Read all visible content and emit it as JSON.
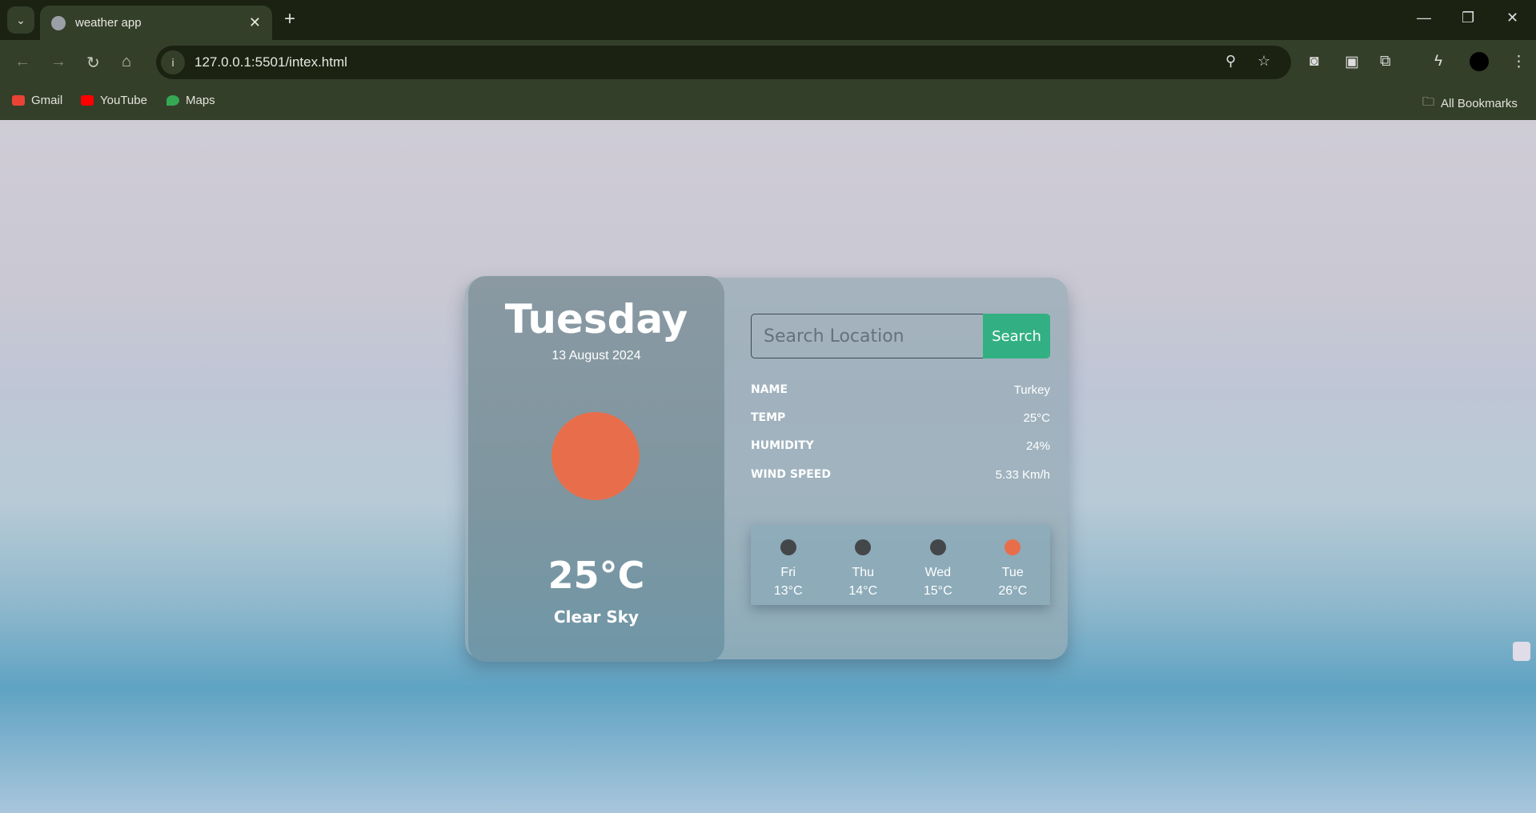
{
  "browser": {
    "tab_title": "weather app",
    "url": "127.0.0.1:5501/intex.html",
    "bookmarks": [
      {
        "label": "Gmail",
        "color": "#ea4335"
      },
      {
        "label": "YouTube",
        "color": "#ff0000"
      },
      {
        "label": "Maps",
        "color": "#34a853"
      }
    ],
    "all_bookmarks": "All Bookmarks"
  },
  "weather": {
    "day": "Tuesday",
    "date": "13 August 2024",
    "icon": "sun-icon",
    "sun_color": "#e86e4b",
    "temp": "25°C",
    "description": "Clear Sky",
    "search_placeholder": "Search Location",
    "search_label": "Search",
    "accent": "#32b083",
    "details": [
      {
        "key": "NAME",
        "value": "Turkey"
      },
      {
        "key": "TEMP",
        "value": "25°C"
      },
      {
        "key": "HUMIDITY",
        "value": "24%"
      },
      {
        "key": "WIND SPEED",
        "value": "5.33 Km/h"
      }
    ],
    "forecast": [
      {
        "day": "Fri",
        "temp": "13°C",
        "color": "#44474a"
      },
      {
        "day": "Thu",
        "temp": "14°C",
        "color": "#44474a"
      },
      {
        "day": "Wed",
        "temp": "15°C",
        "color": "#44474a"
      },
      {
        "day": "Tue",
        "temp": "26°C",
        "color": "#e86e4b"
      }
    ]
  }
}
